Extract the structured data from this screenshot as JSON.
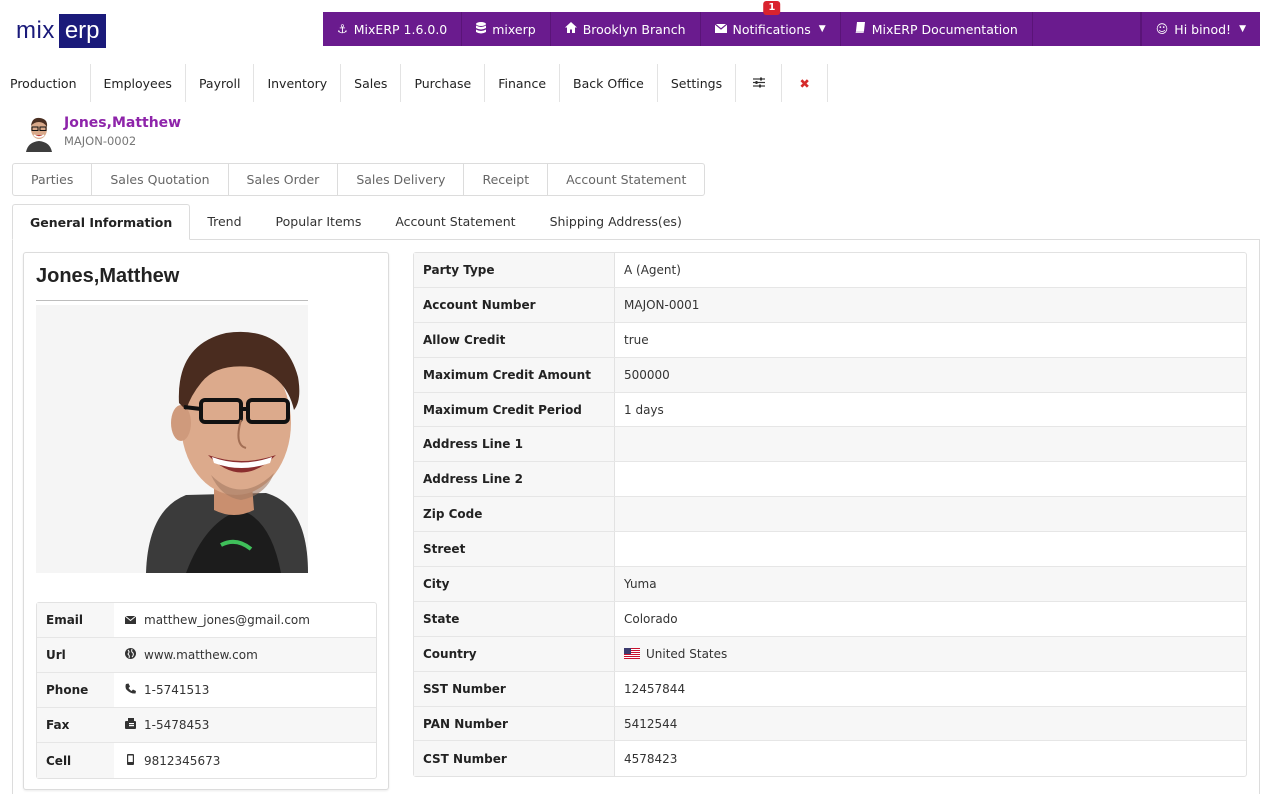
{
  "logo": {
    "mix": "mix",
    "erp": "erp"
  },
  "topbar": {
    "version": "MixERP 1.6.0.0",
    "database": "mixerp",
    "branch": "Brooklyn Branch",
    "notifications": "Notifications",
    "notification_count": "1",
    "documentation": "MixERP Documentation",
    "greeting": "Hi binod!"
  },
  "modules": [
    "Production",
    "Employees",
    "Payroll",
    "Inventory",
    "Sales",
    "Purchase",
    "Finance",
    "Back Office",
    "Settings"
  ],
  "header": {
    "name": "Jones,Matthew",
    "code": "MAJON-0002"
  },
  "subnav": [
    "Parties",
    "Sales Quotation",
    "Sales Order",
    "Sales Delivery",
    "Receipt",
    "Account Statement"
  ],
  "tabs": [
    "General Information",
    "Trend",
    "Popular Items",
    "Account Statement",
    "Shipping Address(es)"
  ],
  "card": {
    "title": "Jones,Matthew",
    "contacts": [
      {
        "label": "Email",
        "value": "matthew_jones@gmail.com",
        "icon": "envelope-icon"
      },
      {
        "label": "Url",
        "value": "www.matthew.com",
        "icon": "globe-icon"
      },
      {
        "label": "Phone",
        "value": "1-5741513",
        "icon": "phone-icon"
      },
      {
        "label": "Fax",
        "value": "1-5478453",
        "icon": "fax-icon"
      },
      {
        "label": "Cell",
        "value": "9812345673",
        "icon": "mobile-icon"
      }
    ]
  },
  "details": [
    {
      "label": "Party Type",
      "value": "A (Agent)"
    },
    {
      "label": "Account Number",
      "value": "MAJON-0001"
    },
    {
      "label": "Allow Credit",
      "value": "true"
    },
    {
      "label": "Maximum Credit Amount",
      "value": "500000"
    },
    {
      "label": "Maximum Credit Period",
      "value": "1 days"
    },
    {
      "label": "Address Line 1",
      "value": ""
    },
    {
      "label": "Address Line 2",
      "value": ""
    },
    {
      "label": "Zip Code",
      "value": ""
    },
    {
      "label": "Street",
      "value": ""
    },
    {
      "label": "City",
      "value": "Yuma"
    },
    {
      "label": "State",
      "value": "Colorado"
    },
    {
      "label": "Country",
      "value": "United States",
      "flag": "us-flag-icon"
    },
    {
      "label": "SST Number",
      "value": "12457844"
    },
    {
      "label": "PAN Number",
      "value": "5412544"
    },
    {
      "label": "CST Number",
      "value": "4578423"
    }
  ],
  "colors": {
    "brand_purple": "#6a1b8e",
    "name_purple": "#8e24aa",
    "logo_navy": "#1a1a7a",
    "badge_red": "#d9232e",
    "close_red": "#d52b2b"
  }
}
